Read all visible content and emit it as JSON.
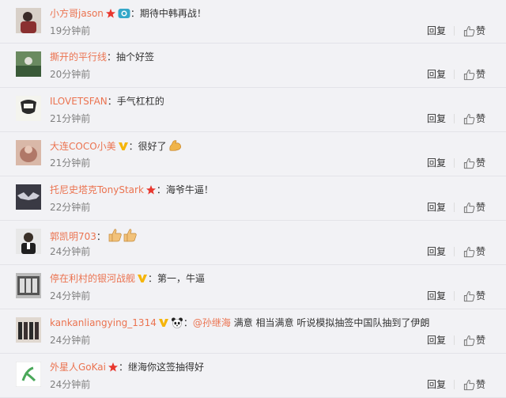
{
  "comments": [
    {
      "user": "小方哥jason",
      "badges": [
        "red-star",
        "camera"
      ],
      "text": "：期待中韩再战！",
      "time": "19分钟前",
      "avatar_color": "#5a3a3a"
    },
    {
      "user": "撕开的平行线",
      "badges": [],
      "text": "：抽个好签",
      "time": "20分钟前",
      "avatar_color": "#3c6a40"
    },
    {
      "user": "ILOVETSFAN",
      "badges": [],
      "text": "：手气杠杠的",
      "time": "21分钟前",
      "avatar_color": "#e8e8e0"
    },
    {
      "user": "大连COCO小美",
      "badges": [
        "gold-v"
      ],
      "text": "：很好了",
      "emoji": "muscle",
      "time": "21分钟前",
      "avatar_color": "#c49a8a"
    },
    {
      "user": "托尼史塔克TonyStark",
      "badges": [
        "red-star"
      ],
      "text": "：海爷牛逼！",
      "time": "22分钟前",
      "avatar_color": "#2a2a30"
    },
    {
      "user": "郭凯明703",
      "badges": [],
      "text": "：",
      "emoji": "thumbs",
      "time": "24分钟前",
      "avatar_color": "#404040"
    },
    {
      "user": "停在利村的银河战舰",
      "badges": [
        "gold-v"
      ],
      "text": "：第一，牛逼",
      "time": "24分钟前",
      "avatar_color": "#6a6a6a"
    },
    {
      "user": "kankanliangying_1314",
      "badges": [
        "gold-v",
        "panda"
      ],
      "text": "：",
      "mention": "@孙继海",
      "text2": " 满意 相当满意 听说模拟抽签中国队抽到了伊朗",
      "time": "24分钟前",
      "avatar_color": "#5a4a4a"
    },
    {
      "user": "外星人GoKai",
      "badges": [
        "red-star"
      ],
      "text": "：继海你这签抽得好",
      "time": "24分钟前",
      "avatar_color": "#ffffff"
    }
  ],
  "actions": {
    "reply": "回复",
    "like": "赞"
  },
  "colors": {
    "username": "#eb7350",
    "background": "#f2f2f5"
  }
}
